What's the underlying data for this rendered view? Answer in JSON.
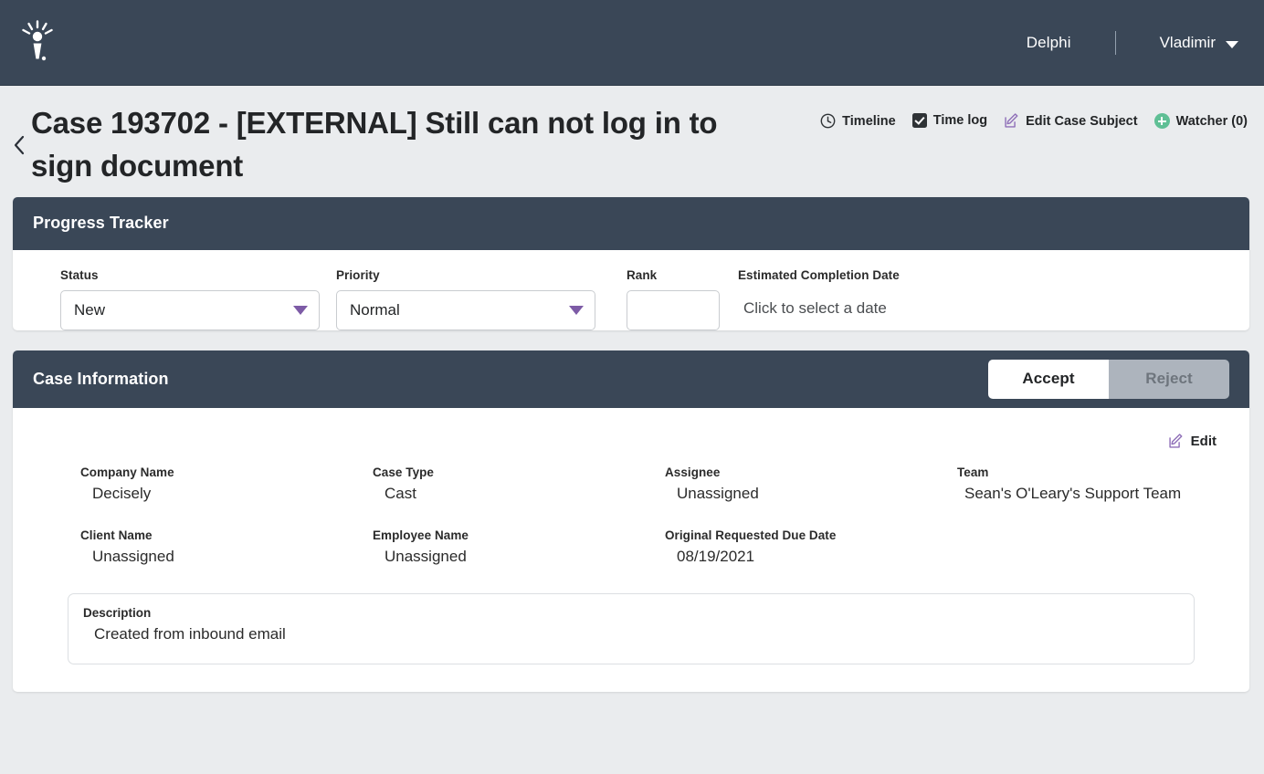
{
  "topnav": {
    "logo_icon": "idea-bulb-logo",
    "app_link": "Delphi",
    "user_name": "Vladimir",
    "caret_icon": "chevron-down-icon"
  },
  "page": {
    "back_icon": "back-chevron-icon",
    "title": "Case 193702 - [EXTERNAL] Still can not log in to sign document",
    "actions": [
      {
        "label": "Timeline",
        "icon": "clock-icon"
      },
      {
        "label": "Time log",
        "icon": "checked-checkbox-icon"
      },
      {
        "label": "Edit Case Subject",
        "icon": "edit-pencil-icon"
      },
      {
        "label": "Watcher (0)",
        "icon": "plus-circle-icon"
      }
    ]
  },
  "progress_tracker": {
    "header": "Progress Tracker",
    "status": {
      "label": "Status",
      "value": "New"
    },
    "priority": {
      "label": "Priority",
      "value": "Normal"
    },
    "rank": {
      "label": "Rank",
      "value": "",
      "placeholder": ""
    },
    "estimated_completion_date": {
      "label": "Estimated Completion Date",
      "value": "Click to select a date"
    }
  },
  "case_information": {
    "header": "Case Information",
    "accept_label": "Accept",
    "reject_label": "Reject",
    "edit_label": "Edit",
    "edit_icon": "edit-pencil-icon",
    "fields": [
      {
        "label": "Company Name",
        "value": "Decisely"
      },
      {
        "label": "Case Type",
        "value": "Cast"
      },
      {
        "label": "Assignee",
        "value": "Unassigned"
      },
      {
        "label": "Team",
        "value": "Sean's O'Leary's Support Team"
      },
      {
        "label": "Client Name",
        "value": "Unassigned"
      },
      {
        "label": "Employee Name",
        "value": "Unassigned"
      },
      {
        "label": "Original Requested Due Date",
        "value": "08/19/2021"
      }
    ],
    "description": {
      "label": "Description",
      "value": "Created from inbound email"
    }
  },
  "colors": {
    "nav_background": "#3a4757",
    "page_background": "#eaecee",
    "accent_purple": "#7d5ba6",
    "accent_green": "#5fbf95",
    "disabled_gray": "#adb4bd"
  }
}
